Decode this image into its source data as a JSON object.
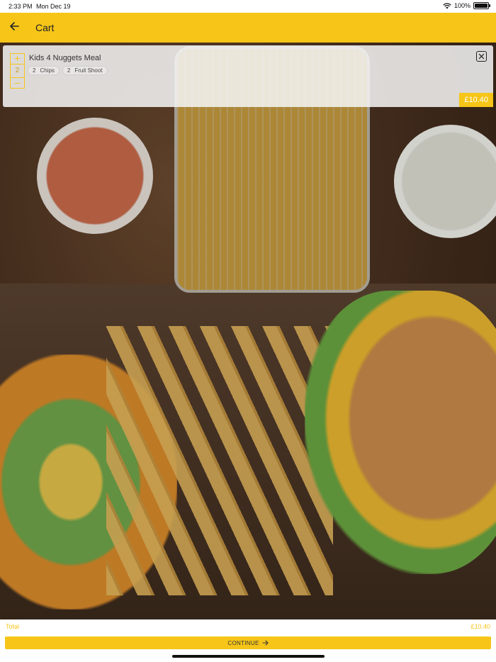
{
  "status_bar": {
    "time": "2:33 PM",
    "date": "Mon Dec 19",
    "battery": "100%",
    "battery_level": 1.0
  },
  "header": {
    "title": "Cart",
    "back_icon": "arrow-left-icon"
  },
  "cart": {
    "items": [
      {
        "name": "Kids 4 Nuggets Meal",
        "quantity": "2",
        "increment_label": "+",
        "decrement_label": "–",
        "modifiers": [
          {
            "qty": "2",
            "name": "Chips"
          },
          {
            "qty": "2",
            "name": "Fruit Shoot"
          }
        ],
        "price": "£10.40"
      }
    ]
  },
  "footer": {
    "total_label": "Total",
    "total_value": "£10.40",
    "continue_label": "CONTINUE",
    "continue_icon": "arrow-right-icon"
  },
  "colors": {
    "accent": "#f6c518",
    "text": "#333333"
  }
}
